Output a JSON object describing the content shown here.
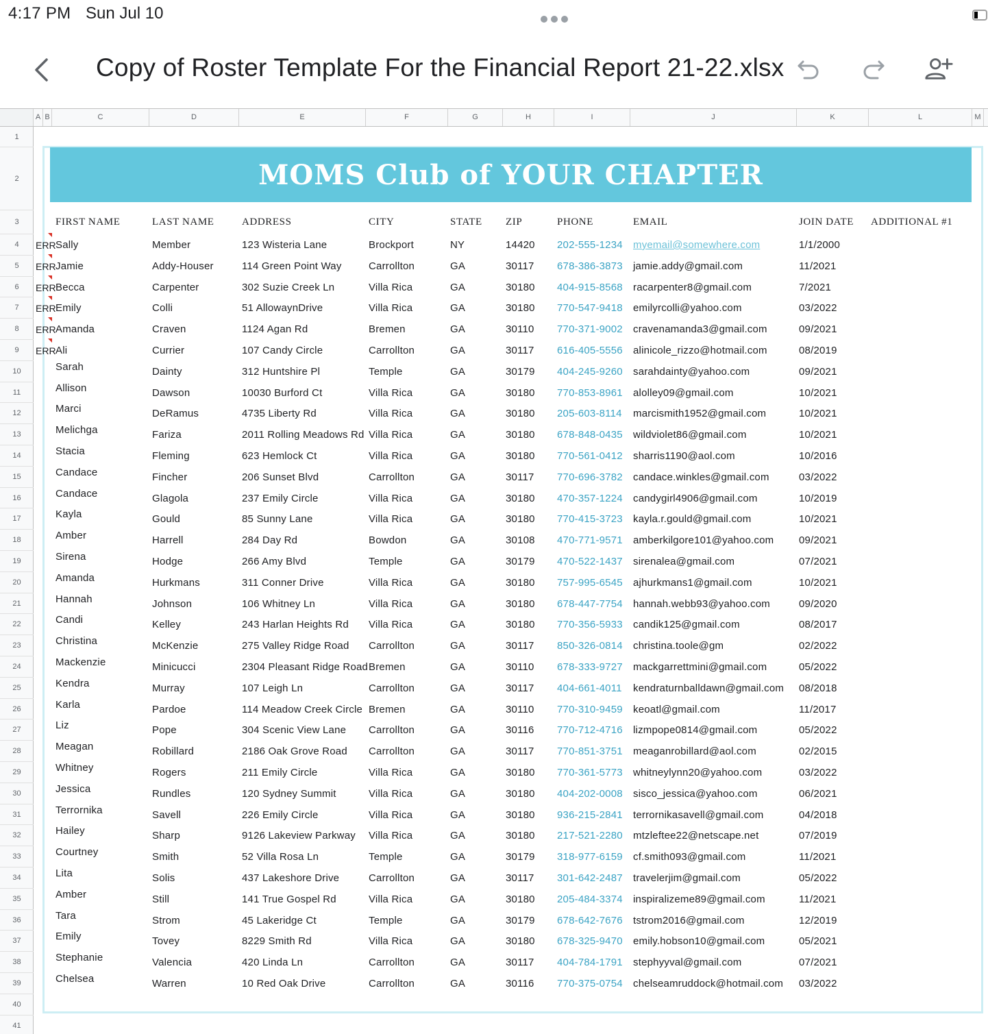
{
  "status_bar": {
    "time": "4:17 PM",
    "date": "Sun Jul 10"
  },
  "app_bar": {
    "title": "Copy of Roster Template For the Financial Report 21-22.xlsx"
  },
  "column_headers": [
    "A",
    "B",
    "C",
    "D",
    "E",
    "F",
    "G",
    "H",
    "I",
    "J",
    "K",
    "L",
    "M"
  ],
  "banner": "MOMS Club of YOUR CHAPTER",
  "table_headers": [
    "FIRST NAME",
    "LAST NAME",
    "ADDRESS",
    "CITY",
    "STATE",
    "ZIP",
    "PHONE",
    "EMAIL",
    "JOIN DATE",
    "ADDITIONAL #1"
  ],
  "err_label": "ERR",
  "rows": [
    {
      "first": "Sally",
      "last": "Member",
      "address": "123 Wisteria Lane",
      "city": "Brockport",
      "state": "NY",
      "zip": "14420",
      "phone": "202-555-1234",
      "email": "myemail@somewhere.com",
      "join": "1/1/2000",
      "err": true
    },
    {
      "first": "Jamie",
      "last": "Addy-Houser",
      "address": "114 Green Point Way",
      "city": "Carrollton",
      "state": "GA",
      "zip": "30117",
      "phone": "678-386-3873",
      "email": "jamie.addy@gmail.com",
      "join": "11/2021",
      "err": true
    },
    {
      "first": "Becca",
      "last": "Carpenter",
      "address": "302 Suzie Creek Ln",
      "city": "Villa Rica",
      "state": "GA",
      "zip": "30180",
      "phone": "404-915-8568",
      "email": "racarpenter8@gmail.com",
      "join": "7/2021",
      "err": true
    },
    {
      "first": "Emily",
      "last": "Colli",
      "address": "51 AllowaynDrive",
      "city": "Villa Rica",
      "state": "GA",
      "zip": "30180",
      "phone": "770-547-9418",
      "email": "emilyrcolli@yahoo.com",
      "join": "03/2022",
      "err": true
    },
    {
      "first": "Amanda",
      "last": "Craven",
      "address": "1124 Agan Rd",
      "city": "Bremen",
      "state": "GA",
      "zip": "30110",
      "phone": "770-371-9002",
      "email": "cravenamanda3@gmail.com",
      "join": "09/2021",
      "err": true
    },
    {
      "first": "Ali",
      "last": "Currier",
      "address": "107 Candy Circle",
      "city": "Carrollton",
      "state": "GA",
      "zip": "30117",
      "phone": "616-405-5556",
      "email": "alinicole_rizzo@hotmail.com",
      "join": "08/2019",
      "err": true
    },
    {
      "first": "Sarah",
      "last": "Dainty",
      "address": "312 Huntshire Pl",
      "city": "Temple",
      "state": "GA",
      "zip": "30179",
      "phone": "404-245-9260",
      "email": "sarahdainty@yahoo.com",
      "join": "09/2021"
    },
    {
      "first": "Allison",
      "last": "Dawson",
      "address": "10030 Burford Ct",
      "city": "Villa Rica",
      "state": "GA",
      "zip": "30180",
      "phone": "770-853-8961",
      "email": "alolley09@gmail.com",
      "join": "10/2021"
    },
    {
      "first": " Marci",
      "last": "DeRamus",
      "address": "4735 Liberty Rd",
      "city": "Villa Rica",
      "state": "GA",
      "zip": "30180",
      "phone": "205-603-8114",
      "email": "marcismith1952@gmail.com",
      "join": "10/2021"
    },
    {
      "first": "Melichga",
      "last": "Fariza",
      "address": "2011 Rolling Meadows Rd",
      "city": "Villa Rica",
      "state": "GA",
      "zip": "30180",
      "phone": "678-848-0435",
      "email": "wildviolet86@gmail.com",
      "join": "10/2021"
    },
    {
      "first": "Stacia",
      "last": "Fleming",
      "address": "623 Hemlock Ct",
      "city": "Villa Rica",
      "state": "GA",
      "zip": "30180",
      "phone": "770-561-0412",
      "email": "sharris1190@aol.com",
      "join": "10/2016"
    },
    {
      "first": "Candace",
      "last": "Fincher",
      "address": "206 Sunset Blvd",
      "city": "Carrollton",
      "state": "GA",
      "zip": "30117",
      "phone": "770-696-3782",
      "email": "candace.winkles@gmail.com",
      "join": "03/2022"
    },
    {
      "first": "Candace",
      "last": "Glagola",
      "address": "237 Emily Circle",
      "city": "Villa Rica",
      "state": "GA",
      "zip": "30180",
      "phone": "470-357-1224",
      "email": "candygirl4906@gmail.com",
      "join": "10/2019"
    },
    {
      "first": "Kayla",
      "last": "Gould",
      "address": "85 Sunny Lane",
      "city": "Villa Rica",
      "state": "GA",
      "zip": "30180",
      "phone": "770-415-3723",
      "email": "kayla.r.gould@gmail.com",
      "join": "10/2021"
    },
    {
      "first": "Amber",
      "last": "Harrell",
      "address": "284 Day Rd",
      "city": "Bowdon",
      "state": "GA",
      "zip": "30108",
      "phone": "470-771-9571",
      "email": "amberkilgore101@yahoo.com",
      "join": "09/2021"
    },
    {
      "first": "Sirena",
      "last": "Hodge",
      "address": "266 Amy Blvd",
      "city": "Temple",
      "state": "GA",
      "zip": "30179",
      "phone": "470-522-1437",
      "email": "sirenalea@gmail.com",
      "join": "07/2021"
    },
    {
      "first": "Amanda",
      "last": "Hurkmans",
      "address": "311 Conner Drive",
      "city": "Villa Rica",
      "state": "GA",
      "zip": "30180",
      "phone": "757-995-6545",
      "email": "ajhurkmans1@gmail.com",
      "join": "10/2021"
    },
    {
      "first": "Hannah",
      "last": "Johnson",
      "address": "106 Whitney Ln",
      "city": "Villa Rica",
      "state": "GA",
      "zip": "30180",
      "phone": "678-447-7754",
      "email": "hannah.webb93@yahoo.com",
      "join": "09/2020"
    },
    {
      "first": "Candi",
      "last": "Kelley",
      "address": "243 Harlan Heights Rd",
      "city": "Villa Rica",
      "state": "GA",
      "zip": "30180",
      "phone": "770-356-5933",
      "email": "candik125@gmail.com",
      "join": "08/2017"
    },
    {
      "first": "Christina",
      "last": "McKenzie",
      "address": "275 Valley Ridge Road",
      "city": "Carrollton",
      "state": "GA",
      "zip": "30117",
      "phone": "850-326-0814",
      "email": "christina.toole@gm",
      "join": "02/2022"
    },
    {
      "first": "Mackenzie",
      "last": "Minicucci",
      "address": "2304 Pleasant Ridge Road",
      "city": "Bremen",
      "state": "GA",
      "zip": "30110",
      "phone": "678-333-9727",
      "email": "mackgarrettmini@gmail.com",
      "join": "05/2022"
    },
    {
      "first": "Kendra",
      "last": "Murray",
      "address": "107 Leigh Ln",
      "city": "Carrollton",
      "state": "GA",
      "zip": "30117",
      "phone": "404-661-4011",
      "email": "kendraturnballdawn@gmail.com",
      "join": "08/2018"
    },
    {
      "first": "Karla",
      "last": "Pardoe",
      "address": "114 Meadow Creek Circle",
      "city": "Bremen",
      "state": "GA",
      "zip": "30110",
      "phone": "770-310-9459",
      "email": "keoatl@gmail.com",
      "join": "11/2017"
    },
    {
      "first": "Liz",
      "last": "Pope",
      "address": "304 Scenic View Lane",
      "city": "Carrollton",
      "state": "GA",
      "zip": "30116",
      "phone": "770-712-4716",
      "email": "lizmpope0814@gmail.com",
      "join": "05/2022"
    },
    {
      "first": "Meagan",
      "last": "Robillard",
      "address": "2186 Oak Grove Road",
      "city": "Carrollton",
      "state": "GA",
      "zip": "30117",
      "phone": "770-851-3751",
      "email": "meaganrobillard@aol.com",
      "join": "02/2015"
    },
    {
      "first": "Whitney",
      "last": "Rogers",
      "address": "211 Emily Circle",
      "city": "Villa Rica",
      "state": "GA",
      "zip": "30180",
      "phone": "770-361-5773",
      "email": "whitneylynn20@yahoo.com",
      "join": "03/2022"
    },
    {
      "first": "Jessica",
      "last": "Rundles",
      "address": "120 Sydney Summit",
      "city": "Villa Rica",
      "state": "GA",
      "zip": "30180",
      "phone": "404-202-0008",
      "email": "sisco_jessica@yahoo.com",
      "join": "06/2021"
    },
    {
      "first": "Terrornika",
      "last": "Savell",
      "address": "226 Emily Circle",
      "city": "Villa Rica",
      "state": "GA",
      "zip": "30180",
      "phone": "936-215-2841",
      "email": "terrornikasavell@gmail.com",
      "join": "04/2018"
    },
    {
      "first": "Hailey",
      "last": "Sharp",
      "address": "9126 Lakeview Parkway",
      "city": "Villa Rica",
      "state": "GA",
      "zip": "30180",
      "phone": "217-521-2280",
      "email": "mtzleftee22@netscape.net",
      "join": "07/2019"
    },
    {
      "first": "Courtney",
      "last": "Smith",
      "address": "52 Villa Rosa Ln",
      "city": "Temple",
      "state": "GA",
      "zip": "30179",
      "phone": "318-977-6159",
      "email": "cf.smith093@gmail.com",
      "join": "11/2021"
    },
    {
      "first": "Lita",
      "last": "Solis",
      "address": "437 Lakeshore Drive",
      "city": "Carrollton",
      "state": "GA",
      "zip": "30117",
      "phone": "301-642-2487",
      "email": "travelerjim@gmail.com",
      "join": "05/2022"
    },
    {
      "first": "Amber",
      "last": "Still",
      "address": "141 True Gospel Rd",
      "city": "Villa Rica",
      "state": "GA",
      "zip": "30180",
      "phone": "205-484-3374",
      "email": "inspiralizeme89@gmail.com",
      "join": "11/2021"
    },
    {
      "first": "Tara",
      "last": "Strom",
      "address": "45 Lakeridge Ct",
      "city": "Temple",
      "state": "GA",
      "zip": "30179",
      "phone": "678-642-7676",
      "email": "tstrom2016@gmail.com",
      "join": "12/2019"
    },
    {
      "first": "Emily",
      "last": "Tovey",
      "address": "8229 Smith Rd",
      "city": "Villa Rica",
      "state": "GA",
      "zip": "30180",
      "phone": "678-325-9470",
      "email": "emily.hobson10@gmail.com",
      "join": "05/2021"
    },
    {
      "first": "Stephanie",
      "last": "Valencia",
      "address": "420 Linda Ln",
      "city": "Carrollton",
      "state": "GA",
      "zip": "30117",
      "phone": "404-784-1791",
      "email": "stephyyval@gmail.com",
      "join": "07/2021"
    },
    {
      "first": "Chelsea",
      "last": "Warren",
      "address": "10 Red Oak Drive",
      "city": "Carrollton",
      "state": "GA",
      "zip": "30116",
      "phone": "770-375-0754",
      "email": "chelseamruddock@hotmail.com",
      "join": "03/2022"
    }
  ],
  "colors": {
    "banner": "#63c7dd",
    "phone_text": "#3aa3c4",
    "frame": "#cdeef4"
  }
}
